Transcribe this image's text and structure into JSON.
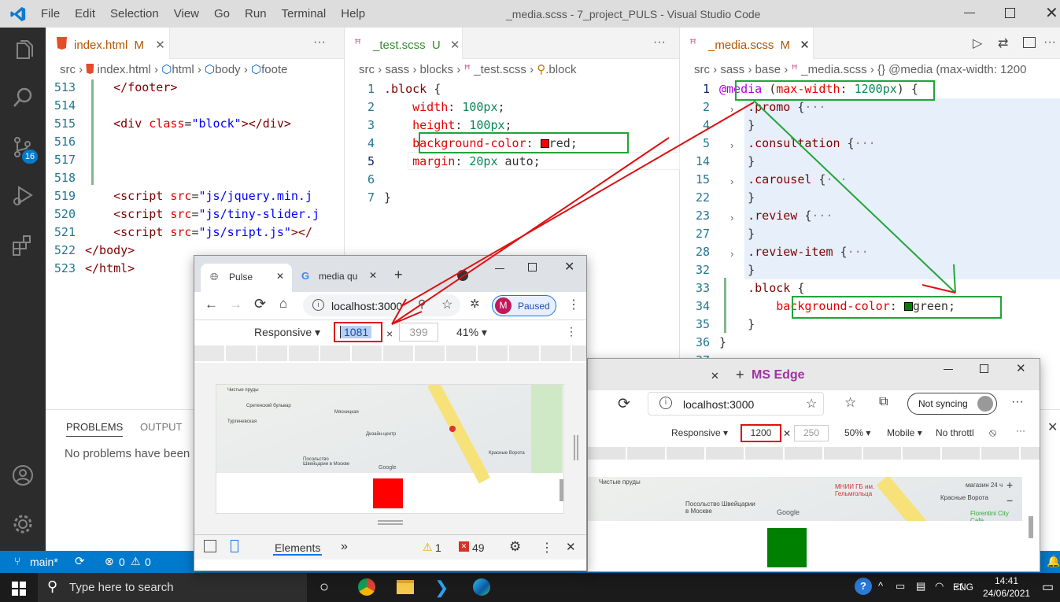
{
  "window": {
    "title": "_media.scss - 7_project_PULS - Visual Studio Code",
    "menu": [
      "File",
      "Edit",
      "Selection",
      "View",
      "Go",
      "Run",
      "Terminal",
      "Help"
    ]
  },
  "activity": {
    "scm_badge": "16"
  },
  "editor1": {
    "tab_label": "index.html",
    "tab_status": "M",
    "breadcrumb": [
      "src",
      "index.html",
      "html",
      "body",
      "foote"
    ],
    "lines": [
      {
        "n": "513",
        "html": "    <span class=\"tag\">&lt;/footer&gt;</span>"
      },
      {
        "n": "514",
        "html": ""
      },
      {
        "n": "515",
        "html": "    <span class=\"tag\">&lt;div</span> <span class=\"attr\">class</span>=<span class=\"val\">\"block\"</span><span class=\"tag\">&gt;&lt;/div&gt;</span>"
      },
      {
        "n": "516",
        "html": ""
      },
      {
        "n": "517",
        "html": ""
      },
      {
        "n": "518",
        "html": ""
      },
      {
        "n": "519",
        "html": "    <span class=\"tag\">&lt;script</span> <span class=\"attr\">src</span>=<span class=\"val\">\"js/jquery.min.j</span>"
      },
      {
        "n": "520",
        "html": "    <span class=\"tag\">&lt;script</span> <span class=\"attr\">src</span>=<span class=\"val\">\"js/tiny-slider.j</span>"
      },
      {
        "n": "521",
        "html": "    <span class=\"tag\">&lt;script</span> <span class=\"attr\">src</span>=<span class=\"val\">\"js/sript.js\"</span><span class=\"tag\">&gt;&lt;/</span>"
      },
      {
        "n": "522",
        "html": "<span class=\"tag\">&lt;/body&gt;</span>"
      },
      {
        "n": "523",
        "html": "<span class=\"tag\">&lt;/html&gt;</span>"
      }
    ]
  },
  "editor2": {
    "tab_label": "_test.scss",
    "tab_status": "U",
    "breadcrumb": [
      "src",
      "sass",
      "blocks",
      "_test.scss",
      ".block"
    ],
    "lines": [
      {
        "n": "1",
        "html": "<span class=\"sel\">.block</span> {"
      },
      {
        "n": "2",
        "html": "    <span class=\"prop\">width</span>: <span class=\"num\">100px</span>;"
      },
      {
        "n": "3",
        "html": "    <span class=\"prop\">height</span>: <span class=\"num\">100px</span>;"
      },
      {
        "n": "4",
        "html": "    <span class=\"prop\">background-color</span>: <span style=\"display:inline-block;width:11px;height:11px;background:#ff0000;border:1px solid #000;vertical-align:-1px\"></span>red;"
      },
      {
        "n": "5",
        "html": "    <span class=\"prop\">margin</span>: <span class=\"num\">20px</span> auto;"
      },
      {
        "n": "6",
        "html": ""
      },
      {
        "n": "7",
        "html": "}"
      }
    ]
  },
  "editor3": {
    "tab_label": "_media.scss",
    "tab_status": "M",
    "breadcrumb": [
      "src",
      "sass",
      "base",
      "_media.scss",
      "{} @media (max-width: 1200"
    ],
    "lines": [
      {
        "n": "1",
        "html": "<span class=\"kw\">@media</span> (<span class=\"prop\">max-width</span>: <span class=\"num\">1200px</span>) {"
      },
      {
        "n": "2",
        "html": "    <span class=\"sel\">.promo</span> {<span style=\"color:#888\">···</span>"
      },
      {
        "n": "4",
        "html": "    }"
      },
      {
        "n": "5",
        "html": "    <span class=\"sel\">.consultation</span> {<span style=\"color:#888\">···</span>"
      },
      {
        "n": "14",
        "html": "    }"
      },
      {
        "n": "15",
        "html": "    <span class=\"sel\">.carousel</span> {<span style=\"color:#888\">···</span>"
      },
      {
        "n": "22",
        "html": "    }"
      },
      {
        "n": "23",
        "html": "    <span class=\"sel\">.review</span> {<span style=\"color:#888\">···</span>"
      },
      {
        "n": "27",
        "html": "    }"
      },
      {
        "n": "28",
        "html": "    <span class=\"sel\">.review-item</span> {<span style=\"color:#888\">···</span>"
      },
      {
        "n": "32",
        "html": "    }"
      },
      {
        "n": "33",
        "html": "    <span class=\"sel\">.block</span> {"
      },
      {
        "n": "34",
        "html": "        <span class=\"prop\">background-color</span>: <span style=\"display:inline-block;width:11px;height:11px;background:#008000;border:1px solid #000;vertical-align:-1px\"></span>green;"
      },
      {
        "n": "35",
        "html": "    }"
      },
      {
        "n": "36",
        "html": "}"
      },
      {
        "n": "37",
        "html": ""
      }
    ]
  },
  "panel": {
    "tabs": [
      "PROBLEMS",
      "OUTPUT"
    ],
    "message": "No problems have been"
  },
  "status": {
    "branch": "main*",
    "errors": "0",
    "warnings": "0"
  },
  "chrome": {
    "tab1": "Pulse",
    "tab2": "media qu",
    "url": "localhost:3000",
    "paused": "Paused",
    "avatar": "M",
    "device": "Responsive",
    "width": "1081",
    "height": "399",
    "zoom": "41%",
    "devtools_tab": "Elements",
    "warnings": "1",
    "errors": "49",
    "map_labels": [
      "Чистые пруды",
      "Сретенский бульвар",
      "Тургеневская",
      "Мясницкая",
      "Дизайн-центр",
      "Посольство Швейцарии в Москве",
      "Красные Ворота",
      "Google"
    ]
  },
  "edge": {
    "tab_label": "MS Edge",
    "url": "localhost:3000",
    "sync": "Not syncing",
    "device": "Responsive",
    "width": "1200",
    "height": "250",
    "zoom": "50%",
    "device_type": "Mobile",
    "throttle": "No throttl",
    "map_labels": [
      "Чистые пруды",
      "МНИИ ГБ им. Гельмгольца",
      "Посольство Швейцарии в Москве",
      "Красные Ворота",
      "магазин 24 ч",
      "Florentini City Cafe",
      "Google"
    ]
  },
  "taskbar": {
    "search": "Type here to search",
    "lang": "ENG",
    "time": "14:41",
    "date": "24/06/2021"
  },
  "colors": {
    "red_block": "#ff0000",
    "green_block": "#008000",
    "annot_green": "#22a43a",
    "annot_red": "#d11111"
  }
}
